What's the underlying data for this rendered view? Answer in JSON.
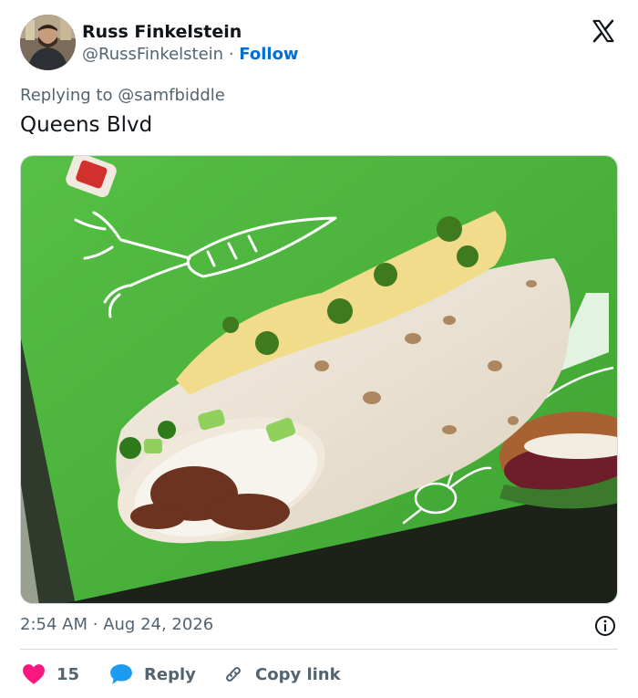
{
  "author": {
    "name": "Russ Finkelstein",
    "handle": "@RussFinkelstein",
    "separator": "·",
    "follow_label": "Follow",
    "avatar_icon": "avatar-photo"
  },
  "brand_icon": "x-logo",
  "reply": {
    "prefix": "Replying to",
    "mention": "@samfbiddle"
  },
  "tweet": {
    "text": "Queens Blvd"
  },
  "media": {
    "description_icon": "burrito-ad-photo"
  },
  "meta": {
    "time": "2:54 AM",
    "separator": "·",
    "date": "Aug 24, 2026",
    "info_icon": "info-icon"
  },
  "actions": {
    "likes_count": "15",
    "reply_label": "Reply",
    "copy_label": "Copy link"
  },
  "colors": {
    "like": "#f91880",
    "reply": "#1d9bf0",
    "link": "#006fd6",
    "muted": "#536471",
    "ad_green": "#4cb43c"
  }
}
